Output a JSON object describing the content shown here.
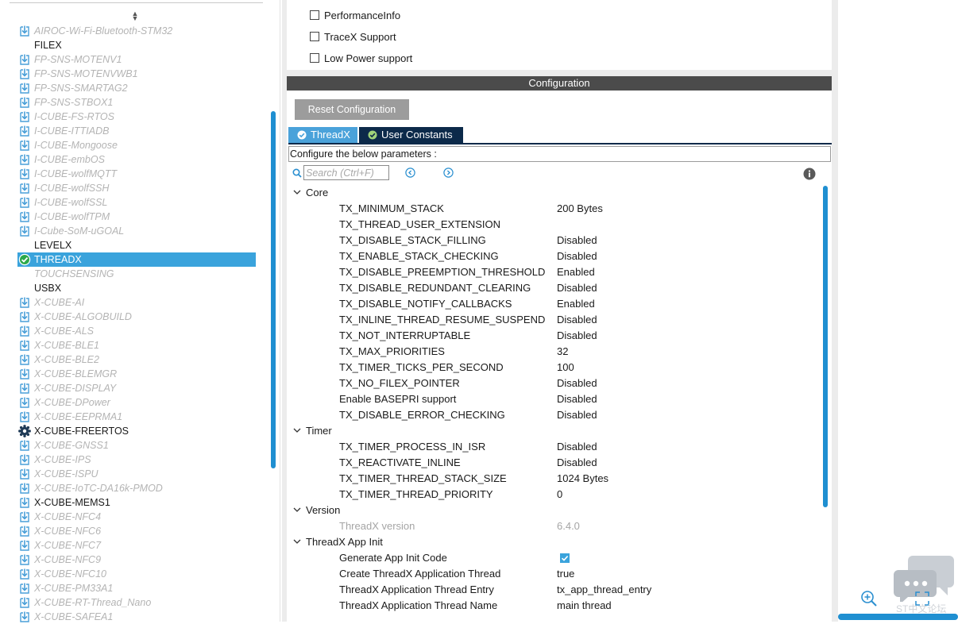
{
  "software_list": [
    {
      "label": "AIROC-Wi-Fi-Bluetooth-STM32",
      "state": "dim",
      "icon": "download-icon"
    },
    {
      "label": "FILEX",
      "state": "plain",
      "icon": ""
    },
    {
      "label": "FP-SNS-MOTENV1",
      "state": "dim",
      "icon": "download-icon"
    },
    {
      "label": "FP-SNS-MOTENVWB1",
      "state": "dim",
      "icon": "download-icon"
    },
    {
      "label": "FP-SNS-SMARTAG2",
      "state": "dim",
      "icon": "download-icon"
    },
    {
      "label": "FP-SNS-STBOX1",
      "state": "dim",
      "icon": "download-icon"
    },
    {
      "label": "I-CUBE-FS-RTOS",
      "state": "dim",
      "icon": "download-icon"
    },
    {
      "label": "I-CUBE-ITTIADB",
      "state": "dim",
      "icon": "download-icon"
    },
    {
      "label": "I-CUBE-Mongoose",
      "state": "dim",
      "icon": "download-icon"
    },
    {
      "label": "I-CUBE-embOS",
      "state": "dim",
      "icon": "download-icon"
    },
    {
      "label": "I-CUBE-wolfMQTT",
      "state": "dim",
      "icon": "download-icon"
    },
    {
      "label": "I-CUBE-wolfSSH",
      "state": "dim",
      "icon": "download-icon"
    },
    {
      "label": "I-CUBE-wolfSSL",
      "state": "dim",
      "icon": "download-icon"
    },
    {
      "label": "I-CUBE-wolfTPM",
      "state": "dim",
      "icon": "download-icon"
    },
    {
      "label": "I-Cube-SoM-uGOAL",
      "state": "dim",
      "icon": "download-icon"
    },
    {
      "label": "LEVELX",
      "state": "plain",
      "icon": ""
    },
    {
      "label": "THREADX",
      "state": "selected",
      "icon": "check-circle-icon"
    },
    {
      "label": "TOUCHSENSING",
      "state": "dim",
      "icon": ""
    },
    {
      "label": "USBX",
      "state": "plain",
      "icon": ""
    },
    {
      "label": "X-CUBE-AI",
      "state": "dim",
      "icon": "download-icon"
    },
    {
      "label": "X-CUBE-ALGOBUILD",
      "state": "dim",
      "icon": "download-icon"
    },
    {
      "label": "X-CUBE-ALS",
      "state": "dim",
      "icon": "download-icon"
    },
    {
      "label": "X-CUBE-BLE1",
      "state": "dim",
      "icon": "download-icon"
    },
    {
      "label": "X-CUBE-BLE2",
      "state": "dim",
      "icon": "download-icon"
    },
    {
      "label": "X-CUBE-BLEMGR",
      "state": "dim",
      "icon": "download-icon"
    },
    {
      "label": "X-CUBE-DISPLAY",
      "state": "dim",
      "icon": "download-icon"
    },
    {
      "label": "X-CUBE-DPower",
      "state": "dim",
      "icon": "download-icon"
    },
    {
      "label": "X-CUBE-EEPRMA1",
      "state": "dim",
      "icon": "download-icon"
    },
    {
      "label": "X-CUBE-FREERTOS",
      "state": "plain",
      "icon": "gear-icon"
    },
    {
      "label": "X-CUBE-GNSS1",
      "state": "dim",
      "icon": "download-icon"
    },
    {
      "label": "X-CUBE-IPS",
      "state": "dim",
      "icon": "download-icon"
    },
    {
      "label": "X-CUBE-ISPU",
      "state": "dim",
      "icon": "download-icon"
    },
    {
      "label": "X-CUBE-IoTC-DA16k-PMOD",
      "state": "dim",
      "icon": "download-icon"
    },
    {
      "label": "X-CUBE-MEMS1",
      "state": "plain",
      "icon": "download-icon"
    },
    {
      "label": "X-CUBE-NFC4",
      "state": "dim",
      "icon": "download-icon"
    },
    {
      "label": "X-CUBE-NFC6",
      "state": "dim",
      "icon": "download-icon"
    },
    {
      "label": "X-CUBE-NFC7",
      "state": "dim",
      "icon": "download-icon"
    },
    {
      "label": "X-CUBE-NFC9",
      "state": "dim",
      "icon": "download-icon"
    },
    {
      "label": "X-CUBE-NFC10",
      "state": "dim",
      "icon": "download-icon"
    },
    {
      "label": "X-CUBE-PM33A1",
      "state": "dim",
      "icon": "download-icon"
    },
    {
      "label": "X-CUBE-RT-Thread_Nano",
      "state": "dim",
      "icon": "download-icon"
    },
    {
      "label": "X-CUBE-SAFEA1",
      "state": "dim",
      "icon": "download-icon"
    }
  ],
  "mode": {
    "options": [
      {
        "label": "PerformanceInfo",
        "checked": false
      },
      {
        "label": "TraceX Support",
        "checked": false
      },
      {
        "label": "Low Power support",
        "checked": false
      }
    ]
  },
  "config": {
    "header": "Configuration",
    "reset_label": "Reset Configuration",
    "tabs": [
      "ThreadX",
      "User Constants"
    ],
    "configure_label": "Configure the below parameters :",
    "search_placeholder": "Search (Ctrl+F)"
  },
  "groups": [
    {
      "name": "Core",
      "params": [
        {
          "name": "TX_MINIMUM_STACK",
          "value": "200 Bytes"
        },
        {
          "name": "TX_THREAD_USER_EXTENSION",
          "value": ""
        },
        {
          "name": "TX_DISABLE_STACK_FILLING",
          "value": "Disabled"
        },
        {
          "name": "TX_ENABLE_STACK_CHECKING",
          "value": "Disabled"
        },
        {
          "name": "TX_DISABLE_PREEMPTION_THRESHOLD",
          "value": "Enabled"
        },
        {
          "name": "TX_DISABLE_REDUNDANT_CLEARING",
          "value": "Disabled"
        },
        {
          "name": "TX_DISABLE_NOTIFY_CALLBACKS",
          "value": "Enabled"
        },
        {
          "name": "TX_INLINE_THREAD_RESUME_SUSPEND",
          "value": "Disabled"
        },
        {
          "name": "TX_NOT_INTERRUPTABLE",
          "value": "Disabled"
        },
        {
          "name": "TX_MAX_PRIORITIES",
          "value": "32"
        },
        {
          "name": "TX_TIMER_TICKS_PER_SECOND",
          "value": "100"
        },
        {
          "name": "TX_NO_FILEX_POINTER",
          "value": "Disabled"
        },
        {
          "name": "Enable BASEPRI support",
          "value": "Disabled"
        },
        {
          "name": "TX_DISABLE_ERROR_CHECKING",
          "value": "Disabled"
        }
      ]
    },
    {
      "name": "Timer",
      "params": [
        {
          "name": "TX_TIMER_PROCESS_IN_ISR",
          "value": "Disabled"
        },
        {
          "name": "TX_REACTIVATE_INLINE",
          "value": "Disabled"
        },
        {
          "name": "TX_TIMER_THREAD_STACK_SIZE",
          "value": "1024 Bytes"
        },
        {
          "name": "TX_TIMER_THREAD_PRIORITY",
          "value": "0"
        }
      ]
    },
    {
      "name": "Version",
      "params": [
        {
          "name": "ThreadX version",
          "value": "6.4.0",
          "readonly": true
        }
      ]
    },
    {
      "name": "ThreadX App Init",
      "params": [
        {
          "name": "Generate App Init Code",
          "value": "",
          "checkbox": true,
          "checked": true
        },
        {
          "name": "Create ThreadX Application Thread",
          "value": "true"
        },
        {
          "name": "ThreadX Application Thread Entry",
          "value": "tx_app_thread_entry"
        },
        {
          "name": "ThreadX Application Thread Name",
          "value": "main thread"
        }
      ]
    }
  ],
  "watermark": "ST中文论坛",
  "colors": {
    "accent": "#3aa3dc",
    "scrollbar": "#1f8fd1",
    "header_dark": "#4b4b4b",
    "tab_dark": "#0c2a4a",
    "reset_button": "#9c9c9c"
  }
}
